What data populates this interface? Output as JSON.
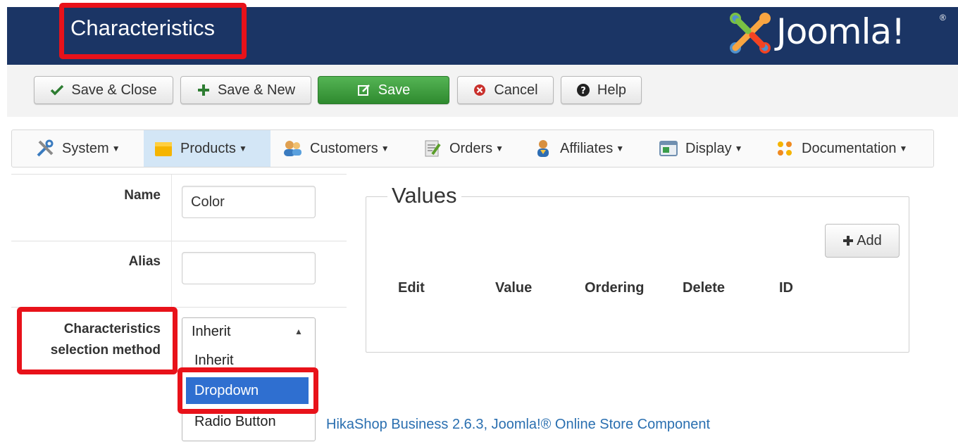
{
  "header": {
    "title": "Characteristics",
    "logo_text": "Joomla!",
    "logo_reg": "®"
  },
  "toolbar": {
    "save_close": "Save & Close",
    "save_new": "Save & New",
    "save": "Save",
    "cancel": "Cancel",
    "help": "Help"
  },
  "menu": {
    "items": [
      {
        "label": "System",
        "icon": "wrench-icon"
      },
      {
        "label": "Products",
        "icon": "folder-icon"
      },
      {
        "label": "Customers",
        "icon": "customers-icon"
      },
      {
        "label": "Orders",
        "icon": "orders-icon"
      },
      {
        "label": "Affiliates",
        "icon": "affiliates-icon"
      },
      {
        "label": "Display",
        "icon": "display-icon"
      },
      {
        "label": "Documentation",
        "icon": "documentation-icon"
      }
    ],
    "active": "Products"
  },
  "form": {
    "name_label": "Name",
    "name_value": "Color",
    "alias_label": "Alias",
    "alias_value": "",
    "method_label_1": "Characteristics",
    "method_label_2": "selection method",
    "method_selected": "Inherit",
    "options": [
      "Inherit",
      "Dropdown",
      "Radio Button"
    ],
    "highlighted_option": "Dropdown"
  },
  "values": {
    "legend": "Values",
    "add_label": "Add",
    "columns": [
      "Edit",
      "Value",
      "Ordering",
      "Delete",
      "ID"
    ]
  },
  "footer": {
    "text": "HikaShop Business 2.6.3, Joomla!® Online Store Component"
  },
  "colors": {
    "header_bg": "#1b3565",
    "highlight_red": "#e8121a",
    "save_green": "#3c9a3c",
    "selected_blue": "#2f6fd0"
  }
}
